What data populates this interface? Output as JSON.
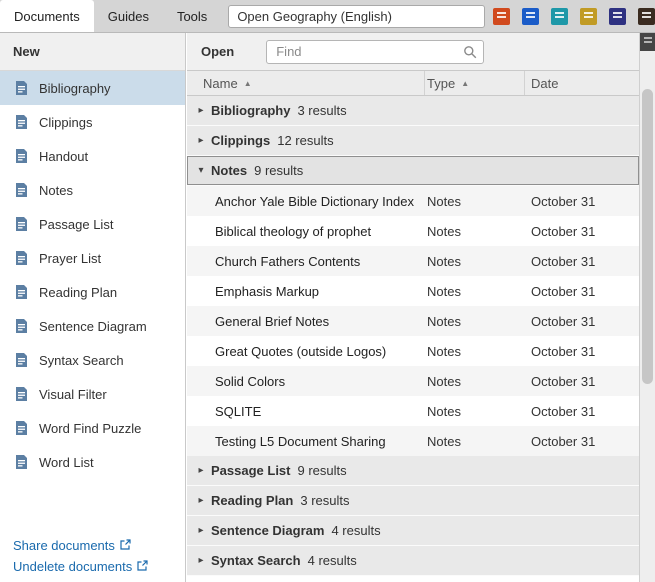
{
  "topbar": {
    "tabs": [
      {
        "label": "Documents",
        "active": true
      },
      {
        "label": "Guides",
        "active": false
      },
      {
        "label": "Tools",
        "active": false
      }
    ],
    "command_input": {
      "value": "Open Geography (English)"
    },
    "shortcut_icons": [
      {
        "name": "shortcut-book-orange",
        "color": "#d14a1e"
      },
      {
        "name": "shortcut-book-blue",
        "color": "#1b5cc8"
      },
      {
        "name": "shortcut-book-teal",
        "color": "#1e98a8"
      },
      {
        "name": "shortcut-book-gold",
        "color": "#c19b25"
      },
      {
        "name": "shortcut-book-purple",
        "color": "#2e3181"
      },
      {
        "name": "shortcut-book-dark",
        "color": "#3a2b20"
      }
    ]
  },
  "sidebar": {
    "header": "New",
    "items": [
      {
        "label": "Bibliography",
        "selected": true
      },
      {
        "label": "Clippings",
        "selected": false
      },
      {
        "label": "Handout",
        "selected": false
      },
      {
        "label": "Notes",
        "selected": false
      },
      {
        "label": "Passage List",
        "selected": false
      },
      {
        "label": "Prayer List",
        "selected": false
      },
      {
        "label": "Reading Plan",
        "selected": false
      },
      {
        "label": "Sentence Diagram",
        "selected": false
      },
      {
        "label": "Syntax Search",
        "selected": false
      },
      {
        "label": "Visual Filter",
        "selected": false
      },
      {
        "label": "Word Find Puzzle",
        "selected": false
      },
      {
        "label": "Word List",
        "selected": false
      }
    ],
    "links": [
      {
        "label": "Share documents"
      },
      {
        "label": "Undelete documents"
      }
    ]
  },
  "main": {
    "header": "Open",
    "find_placeholder": "Find",
    "columns": [
      {
        "label": "Name",
        "sorted": true
      },
      {
        "label": "Type",
        "sorted": true
      },
      {
        "label": "Date",
        "sorted": false
      }
    ],
    "groups": [
      {
        "label": "Bibliography",
        "count": "3 results",
        "expanded": false,
        "selected": false
      },
      {
        "label": "Clippings",
        "count": "12 results",
        "expanded": false,
        "selected": false
      },
      {
        "label": "Notes",
        "count": "9 results",
        "expanded": true,
        "selected": true,
        "items": [
          {
            "name": "Anchor Yale Bible Dictionary Index",
            "type": "Notes",
            "date": "October 31"
          },
          {
            "name": "Biblical theology of prophet",
            "type": "Notes",
            "date": "October 31"
          },
          {
            "name": "Church Fathers Contents",
            "type": "Notes",
            "date": "October 31"
          },
          {
            "name": "Emphasis Markup",
            "type": "Notes",
            "date": "October 31"
          },
          {
            "name": "General Brief Notes",
            "type": "Notes",
            "date": "October 31"
          },
          {
            "name": "Great Quotes (outside Logos)",
            "type": "Notes",
            "date": "October 31"
          },
          {
            "name": "Solid Colors",
            "type": "Notes",
            "date": "October 31"
          },
          {
            "name": "SQLITE",
            "type": "Notes",
            "date": "October 31"
          },
          {
            "name": "Testing L5 Document Sharing",
            "type": "Notes",
            "date": "October 31"
          }
        ]
      },
      {
        "label": "Passage List",
        "count": "9 results",
        "expanded": false,
        "selected": false
      },
      {
        "label": "Reading Plan",
        "count": "3 results",
        "expanded": false,
        "selected": false
      },
      {
        "label": "Sentence Diagram",
        "count": "4 results",
        "expanded": false,
        "selected": false
      },
      {
        "label": "Syntax Search",
        "count": "4 results",
        "expanded": false,
        "selected": false
      }
    ]
  },
  "icons": {
    "caret_collapsed": "▸",
    "caret_expanded": "▾",
    "sort_asc": "▲"
  }
}
